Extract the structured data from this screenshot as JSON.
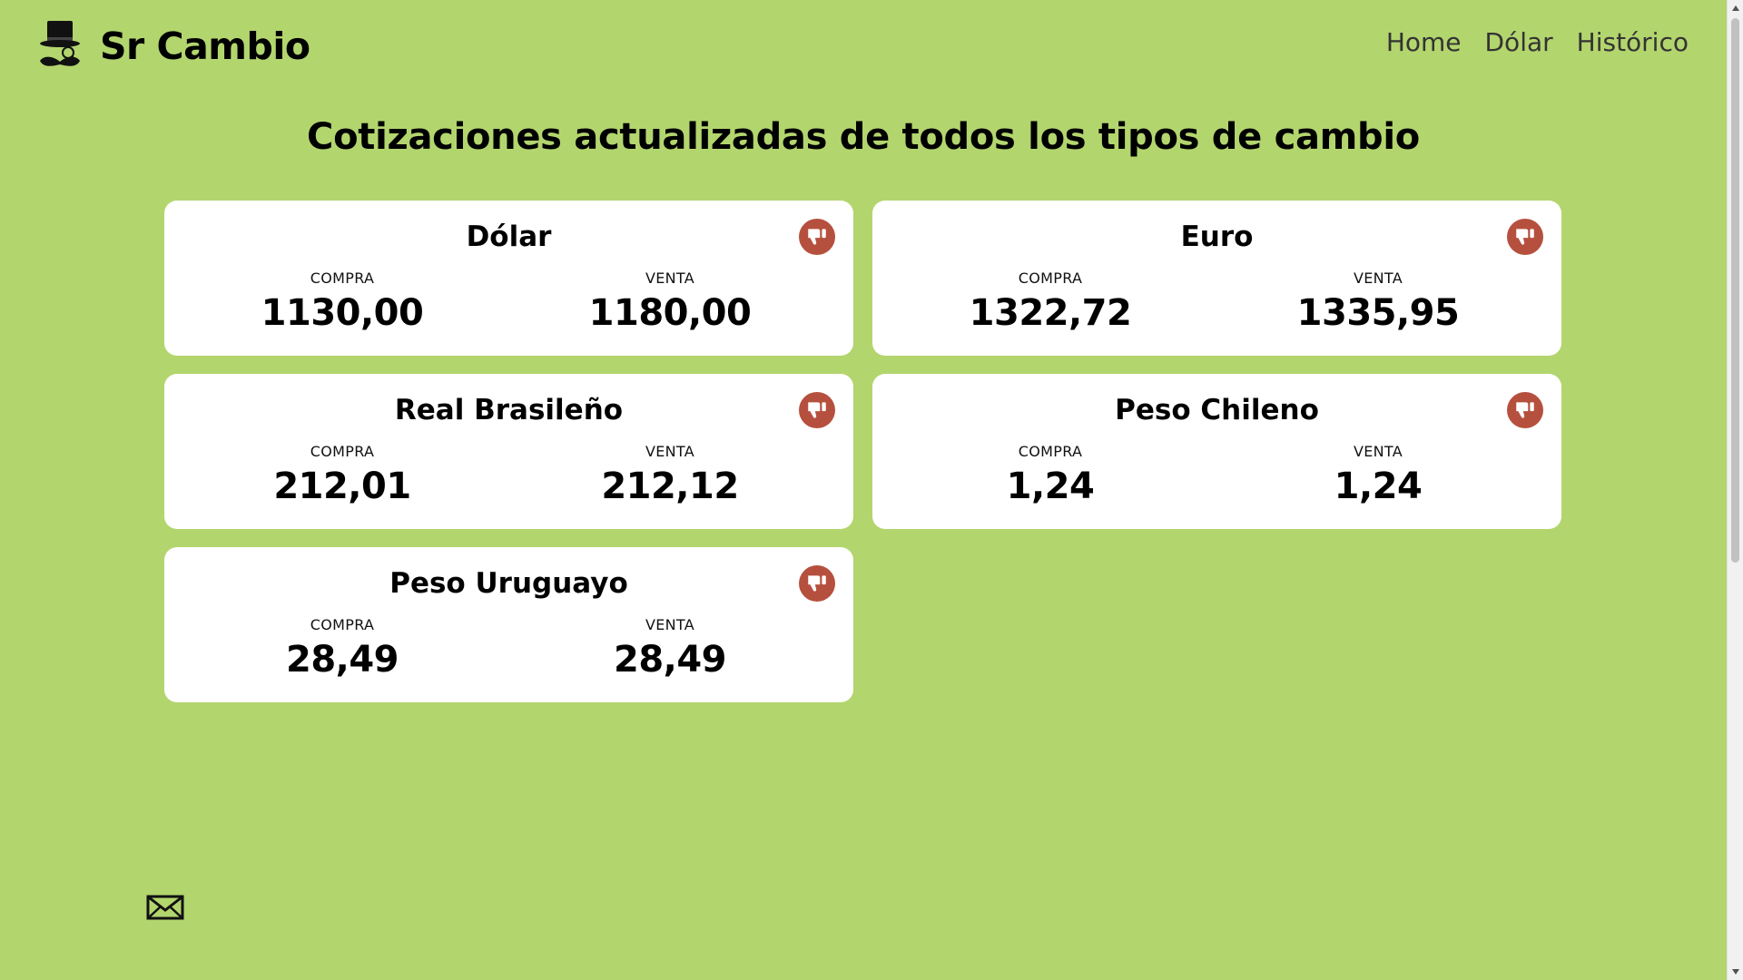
{
  "header": {
    "brand": "Sr Cambio",
    "nav": [
      "Home",
      "Dólar",
      "Histórico"
    ]
  },
  "main": {
    "title": "Cotizaciones actualizadas de todos los tipos de cambio",
    "buy_label": "COMPRA",
    "sell_label": "VENTA",
    "cards": [
      {
        "name": "Dólar",
        "compra": "1130,00",
        "venta": "1180,00"
      },
      {
        "name": "Euro",
        "compra": "1322,72",
        "venta": "1335,95"
      },
      {
        "name": "Real Brasileño",
        "compra": "212,01",
        "venta": "212,12"
      },
      {
        "name": "Peso Chileno",
        "compra": "1,24",
        "venta": "1,24"
      },
      {
        "name": "Peso Uruguayo",
        "compra": "28,49",
        "venta": "28,49"
      }
    ]
  },
  "icons": {
    "logo": "top-hat-monocle-mustache-icon",
    "card_action": "thumbs-down-icon",
    "footer": "envelope-icon"
  },
  "colors": {
    "background": "#b3d56e",
    "card": "#ffffff",
    "dislike_button": "#b6503e"
  }
}
